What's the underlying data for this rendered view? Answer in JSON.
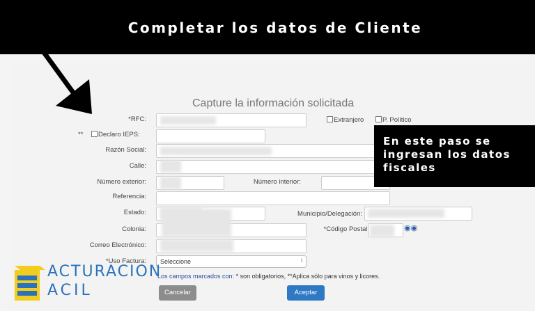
{
  "banner": {
    "title": "Completar los datos de Cliente"
  },
  "form": {
    "title": "Capture la información solicitada",
    "labels": {
      "rfc": "*RFC:",
      "ieps_prefix": "**",
      "ieps": "Declaro IEPS:",
      "razon_social": "Razón Social:",
      "calle": "Calle:",
      "numero_exterior": "Número exterior:",
      "numero_interior": "Número interior:",
      "referencia": "Referencia:",
      "estado": "Estado:",
      "municipio": "Municipio/Delegación:",
      "colonia": "Colonia:",
      "codigo_postal": "*Código Postal:",
      "correo": "Correo Electrónico:",
      "uso_factura": "*Uso Factura:"
    },
    "checkboxes": {
      "extranjero": "Extranjero",
      "politico": "P. Político"
    },
    "uso_factura_value": "Seleccione",
    "note_link": "Los campos marcados con:",
    "note_text": " * son obligatorios, **Aplica sólo para vinos y licores.",
    "buttons": {
      "cancel": "Cancelar",
      "accept": "Aceptar"
    }
  },
  "callout": {
    "text": "En este paso se ingresan los datos fiscales"
  },
  "logo": {
    "line1": "ACTURACION",
    "line2": "ACIL"
  },
  "colors": {
    "accent": "#2f78c4",
    "logo": "#2a72bd",
    "banner": "#000000"
  }
}
